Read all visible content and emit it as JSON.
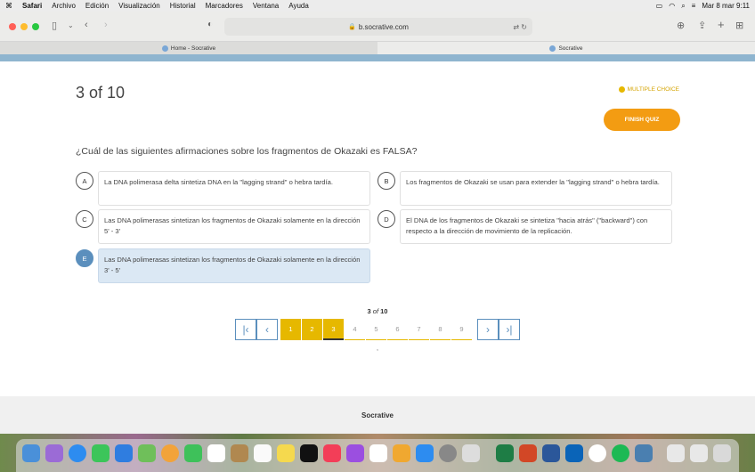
{
  "menubar": {
    "apple": "",
    "items": [
      "Safari",
      "Archivo",
      "Edición",
      "Visualización",
      "Historial",
      "Marcadores",
      "Ventana",
      "Ayuda"
    ],
    "clock": "Mar 8 mar  9:11"
  },
  "browser": {
    "url": "b.socrative.com",
    "tabs": [
      {
        "label": "Home - Socrative",
        "active": false
      },
      {
        "label": "Socrative",
        "active": true
      }
    ]
  },
  "quiz": {
    "counter": "3 of 10",
    "question_type": "MULTIPLE CHOICE",
    "finish_label": "FINISH QUIZ",
    "question": "¿Cuál de las siguientes afirmaciones sobre los fragmentos de Okazaki es FALSA?",
    "answers": [
      {
        "letter": "A",
        "text": "La DNA polimerasa delta sintetiza DNA en la \"lagging strand\" o hebra tardía.",
        "selected": false
      },
      {
        "letter": "B",
        "text": "Los fragmentos de Okazaki se usan para extender la \"lagging strand\" o hebra tardía.",
        "selected": false
      },
      {
        "letter": "C",
        "text": "Las DNA polimerasas sintetizan los fragmentos de Okazaki solamente en la dirección 5' - 3'",
        "selected": false
      },
      {
        "letter": "D",
        "text": "El DNA de los fragmentos de Okazaki se sintetiza \"hacia atrás\" (\"backward\") con respecto a la dirección de movimiento de la replicación.",
        "selected": false
      },
      {
        "letter": "E",
        "text": "Las DNA polimerasas sintetizan los fragmentos de Okazaki solamente en la dirección 3' - 5'",
        "selected": true
      }
    ]
  },
  "pagination": {
    "current": "3",
    "of_word": "of",
    "total": "10",
    "pages": [
      "1",
      "2",
      "3",
      "4",
      "5",
      "6",
      "7",
      "8",
      "9"
    ],
    "first_icon": "first-page-icon",
    "prev_icon": "chevron-left-icon",
    "next_icon": "chevron-right-icon",
    "last_icon": "last-page-icon",
    "tick": ","
  },
  "footer": {
    "brand": "Socrative"
  },
  "colors": {
    "accent_orange": "#f39c12",
    "progress_yellow": "#e6b800",
    "selected_blue": "#5b8fbd"
  }
}
